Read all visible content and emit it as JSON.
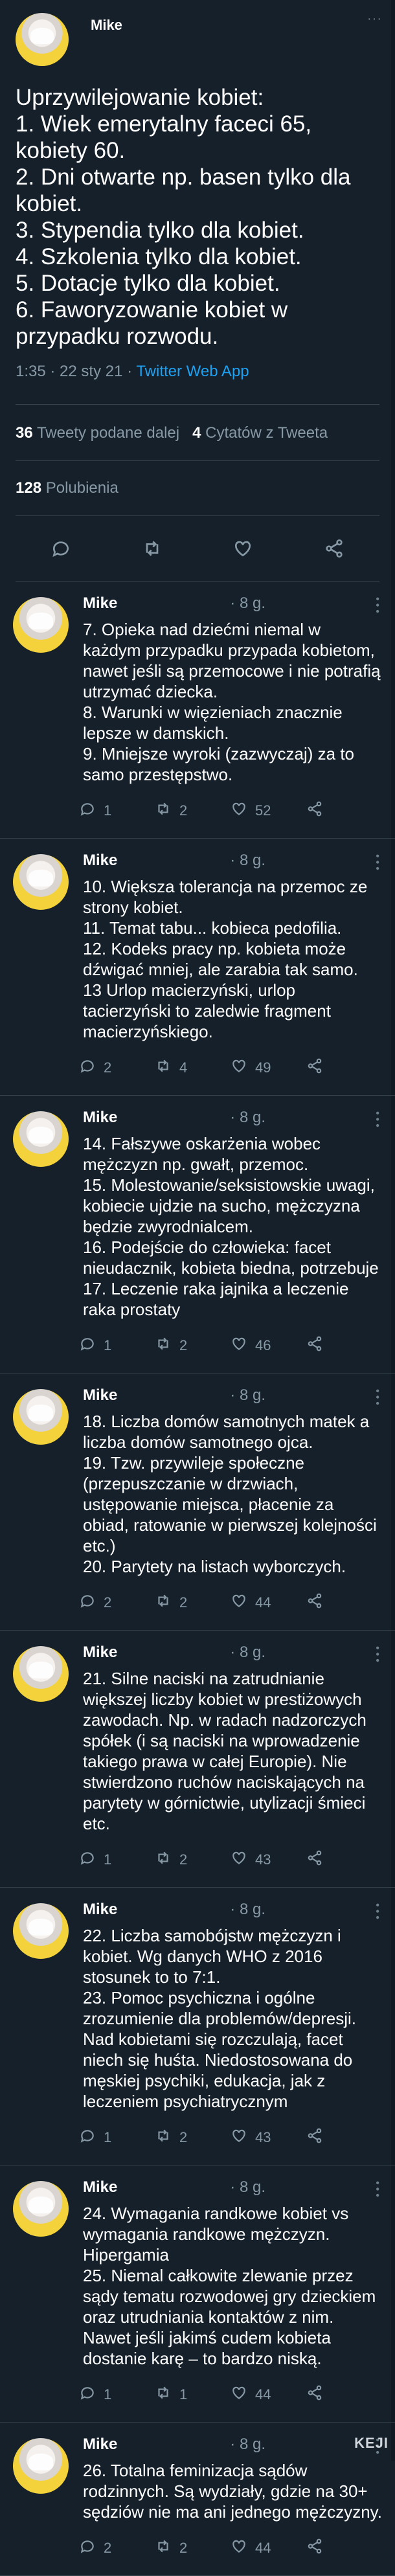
{
  "main_tweet": {
    "author": "Mike",
    "text": "Uprzywilejowanie kobiet:\n1. Wiek emerytalny faceci 65, kobiety 60.\n2. Dni otwarte np. basen tylko dla kobiet.\n3. Stypendia tylko dla kobiet.\n4. Szkolenia tylko dla kobiet.\n5. Dotacje tylko dla kobiet.\n6. Faworyzowanie kobiet w przypadku rozwodu.",
    "timestamp": "1:35 · 22 sty 21 · ",
    "source": "Twitter Web App",
    "retweets_count": "36",
    "retweets_label": "Tweety podane dalej",
    "quotes_count": "4",
    "quotes_label": "Cytatów z Tweeta",
    "likes_count": "128",
    "likes_label": "Polubienia",
    "more_icon": "···"
  },
  "replies": [
    {
      "author": "Mike",
      "time": "· 8 g.",
      "text": "7. Opieka nad dziećmi niemal w każdym przypadku przypada kobietom, nawet jeśli są przemocowe i nie potrafią utrzymać dziecka.\n8. Warunki w więzieniach znacznie lepsze w damskich.\n9. Mniejsze wyroki (zazwyczaj) za to samo przestępstwo.",
      "replies": "1",
      "retweets": "2",
      "likes": "52"
    },
    {
      "author": "Mike",
      "time": "· 8 g.",
      "text": "10. Większa tolerancja na przemoc ze strony kobiet.\n11. Temat tabu... kobieca pedofilia.\n12. Kodeks pracy np. kobieta może dźwigać mniej, ale zarabia tak samo.\n13 Urlop macierzyński, urlop tacierzyński to zaledwie fragment macierzyńskiego.",
      "replies": "2",
      "retweets": "4",
      "likes": "49"
    },
    {
      "author": "Mike",
      "time": "· 8 g.",
      "text": "14. Fałszywe oskarżenia wobec mężczyzn np. gwałt, przemoc.\n15. Molestowanie/seksistowskie uwagi, kobiecie ujdzie na sucho, mężczyzna będzie zwyrodnialcem.\n16. Podejście do człowieka: facet nieudacznik, kobieta biedna, potrzebuje\n17. Leczenie raka jajnika a leczenie raka prostaty",
      "replies": "1",
      "retweets": "2",
      "likes": "46"
    },
    {
      "author": "Mike",
      "time": "· 8 g.",
      "text": "18. Liczba domów samotnych matek a liczba domów samotnego ojca.\n19. Tzw. przywileje społeczne (przepuszczanie w drzwiach, ustępowanie miejsca, płacenie za obiad, ratowanie w pierwszej kolejności etc.)\n20. Parytety na listach wyborczych.",
      "replies": "2",
      "retweets": "2",
      "likes": "44"
    },
    {
      "author": "Mike",
      "time": "· 8 g.",
      "text": "21. Silne naciski na zatrudnianie większej liczby kobiet w prestiżowych zawodach. Np. w radach nadzorczych spółek (i są naciski na wprowadzenie takiego prawa w całej Europie). Nie stwierdzono ruchów naciskających na parytety w górnictwie, utylizacji śmieci etc.",
      "replies": "1",
      "retweets": "2",
      "likes": "43"
    },
    {
      "author": "Mike",
      "time": "· 8 g.",
      "text": "22. Liczba samobójstw mężczyzn i kobiet. Wg danych WHO z 2016 stosunek to to 7:1.\n23. Pomoc psychiczna i ogólne zrozumienie dla problemów/depresji. Nad kobietami się rozczulają, facet niech się huśta. Niedostosowana do męskiej psychiki, edukacja, jak z leczeniem psychiatrycznym",
      "replies": "1",
      "retweets": "2",
      "likes": "43"
    },
    {
      "author": "Mike",
      "time": "· 8 g.",
      "text": "24. Wymagania randkowe kobiet vs wymagania randkowe mężczyzn. Hipergamia\n25. Niemal całkowite zlewanie przez sądy tematu rozwodowej gry dzieckiem oraz utrudniania kontaktów z nim. Nawet jeśli jakimś cudem kobieta dostanie karę – to bardzo niską.",
      "replies": "1",
      "retweets": "1",
      "likes": "44"
    },
    {
      "author": "Mike",
      "time": "· 8 g.",
      "text": "26. Totalna feminizacja sądów rodzinnych. Są wydziały, gdzie na 30+ sędziów nie ma ani jednego mężczyzny.",
      "replies": "2",
      "retweets": "2",
      "likes": "44"
    }
  ],
  "watermark": "KEJI",
  "colors": {
    "background": "#15202b",
    "text": "#ffffff",
    "muted": "#8899a6",
    "link": "#1da1f2",
    "divider": "#38444d"
  },
  "icons": [
    "reply-icon",
    "retweet-icon",
    "like-icon",
    "share-icon",
    "more-icon",
    "avatar"
  ]
}
